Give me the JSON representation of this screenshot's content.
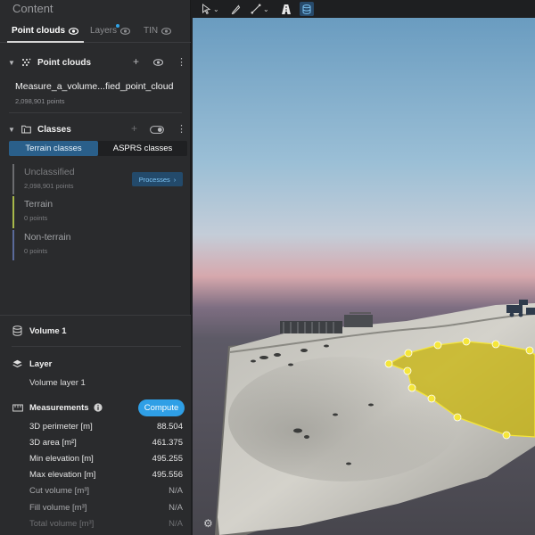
{
  "panel": {
    "title": "Content",
    "tabs": [
      {
        "label": "Point clouds",
        "active": true
      },
      {
        "label": "Layers",
        "active": false
      },
      {
        "label": "TIN",
        "active": false
      }
    ]
  },
  "point_clouds": {
    "label": "Point clouds",
    "item": {
      "name": "Measure_a_volume...fied_point_cloud",
      "points": "2,098,901 points"
    }
  },
  "classes": {
    "label": "Classes",
    "tabs": [
      {
        "label": "Terrain classes",
        "active": true
      },
      {
        "label": "ASPRS classes",
        "active": false
      }
    ],
    "items": [
      {
        "name": "Unclassified",
        "count": "2,098,901 points",
        "color": "#6b6c6f"
      },
      {
        "name": "Terrain",
        "count": "0 points",
        "color": "#a7b84a"
      },
      {
        "name": "Non-terrain",
        "count": "0 points",
        "color": "#5a6a9a"
      }
    ],
    "processes_label": "Processes"
  },
  "volume": {
    "title": "Volume 1",
    "layer_label": "Layer",
    "layer_value": "Volume layer 1",
    "measurements_label": "Measurements",
    "compute_label": "Compute",
    "rows": [
      {
        "label": "3D perimeter [m]",
        "value": "88.504"
      },
      {
        "label": "3D area [m²]",
        "value": "461.375"
      },
      {
        "label": "Min elevation [m]",
        "value": "495.255"
      },
      {
        "label": "Max elevation [m]",
        "value": "495.556"
      },
      {
        "label": "Cut volume [m³]",
        "value": "N/A"
      },
      {
        "label": "Fill volume [m³]",
        "value": "N/A"
      },
      {
        "label": "Total volume [m³]",
        "value": "N/A"
      }
    ]
  },
  "colors": {
    "accent": "#2f9fe6",
    "polygon_fill": "#c8b300",
    "vertex": "#f5e63a"
  },
  "icons": [
    "eye-icon",
    "plus-icon",
    "more-icon",
    "folder-icon",
    "toggle-icon",
    "database-icon",
    "layers-icon",
    "ruler-icon",
    "info-icon",
    "gear-icon",
    "cursor-icon",
    "pen-icon",
    "line-icon",
    "road-icon"
  ]
}
